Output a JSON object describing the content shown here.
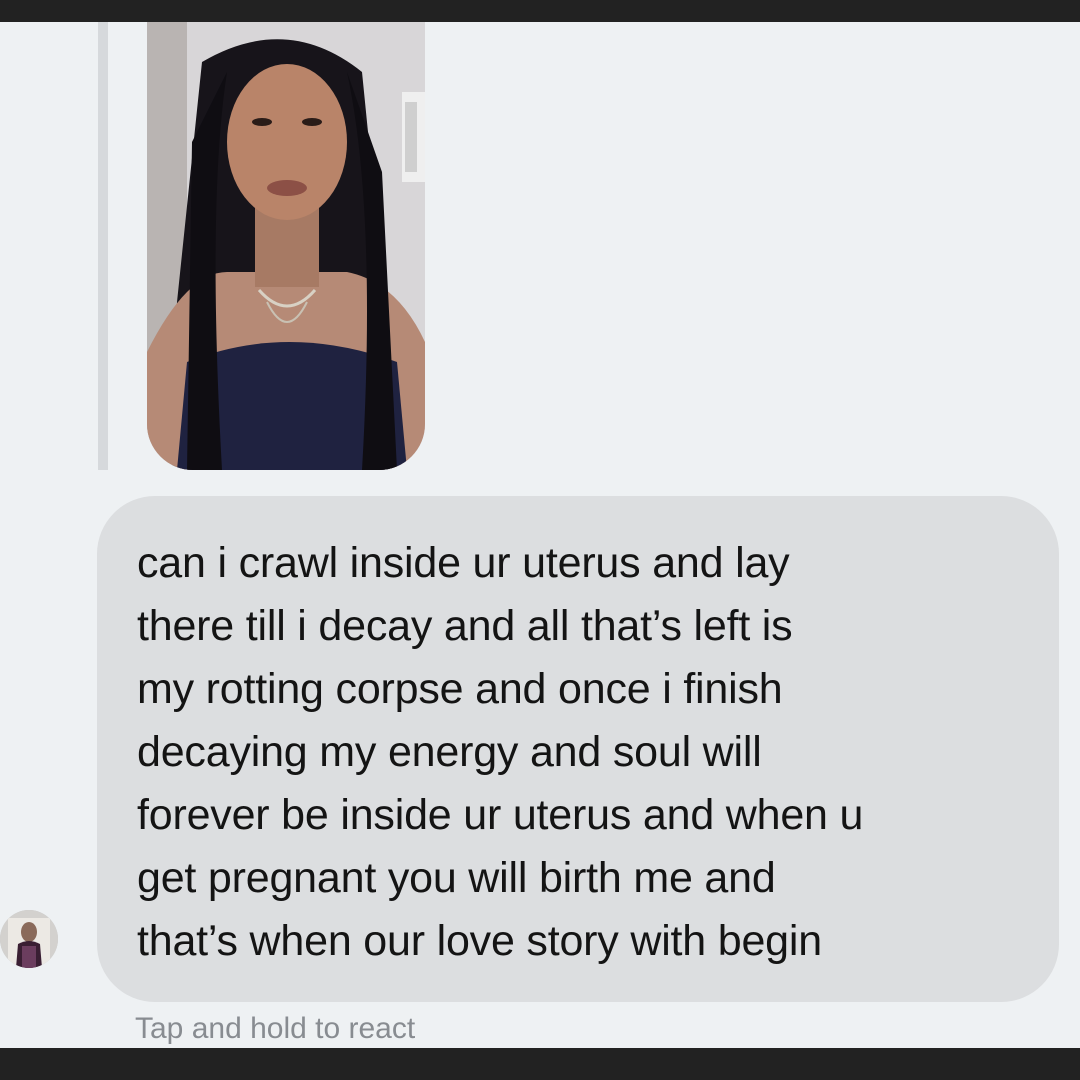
{
  "chat": {
    "image_message": {
      "type": "photo",
      "icon": "photo-message"
    },
    "text_message": {
      "text": "can i crawl inside ur uterus and lay\nthere till i decay and all that’s left is\nmy rotting corpse and once i finish\ndecaying my energy and soul will\nforever be inside ur uterus and when u\nget pregnant you will birth me and\nthat’s when our love story with begin"
    },
    "sender": {
      "avatar_icon": "profile-photo-icon"
    },
    "react_hint": "Tap and hold to react"
  },
  "colors": {
    "background": "#eef1f3",
    "bubble": "#dcdee0",
    "text": "#141414",
    "hint": "#888c91"
  }
}
